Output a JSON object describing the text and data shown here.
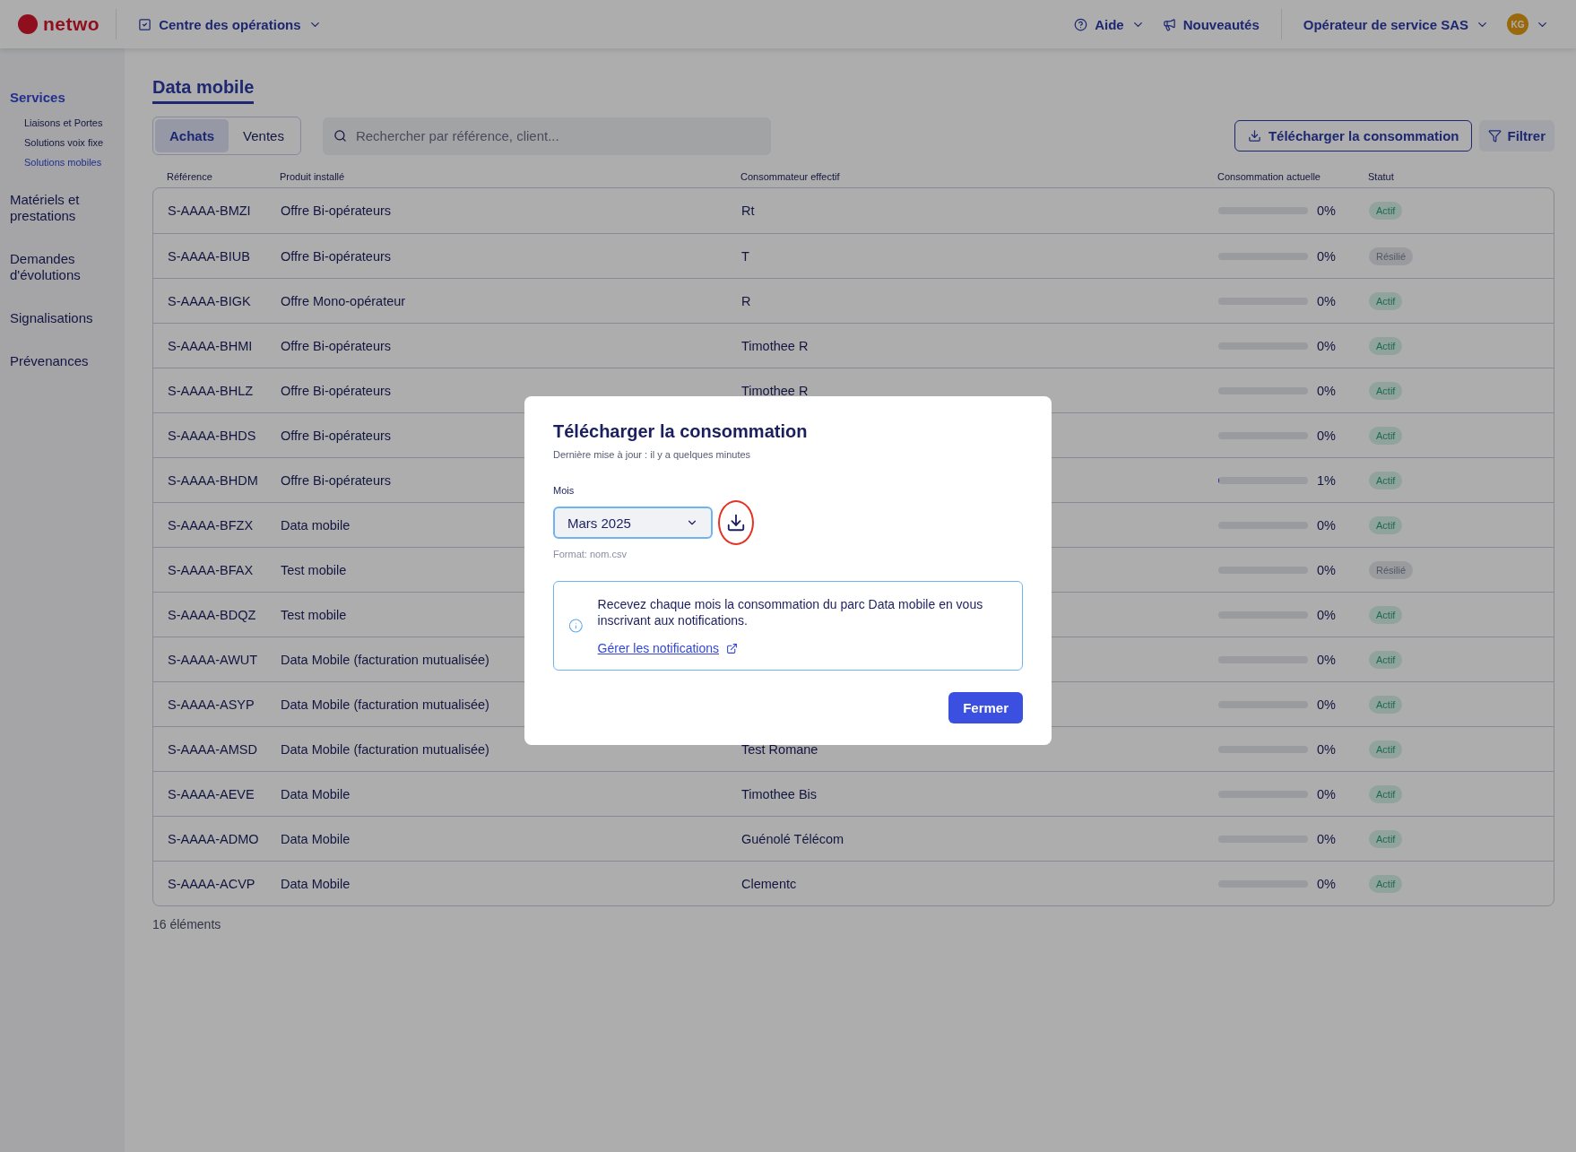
{
  "header": {
    "logo": "netwo",
    "app_menu": "Centre des opérations",
    "help": "Aide",
    "news": "Nouveautés",
    "account": "Opérateur de service SAS",
    "avatar": "KG"
  },
  "sidebar": {
    "items": [
      {
        "label": "Services",
        "selected": true,
        "children": [
          {
            "label": "Liaisons et Portes",
            "selected": false
          },
          {
            "label": "Solutions voix fixe",
            "selected": false
          },
          {
            "label": "Solutions mobiles",
            "selected": true
          }
        ]
      },
      {
        "label": "Matériels et prestations",
        "selected": false
      },
      {
        "label": "Demandes d'évolutions",
        "selected": false
      },
      {
        "label": "Signalisations",
        "selected": false
      },
      {
        "label": "Prévenances",
        "selected": false
      }
    ]
  },
  "page": {
    "title": "Data mobile",
    "tabs": [
      {
        "label": "Achats",
        "selected": true
      },
      {
        "label": "Ventes",
        "selected": false
      }
    ],
    "search": {
      "placeholder": "Rechercher par référence, client..."
    },
    "download_button": "Télécharger la consommation",
    "filter_button": "Filtrer"
  },
  "table": {
    "columns": [
      "Référence",
      "Produit installé",
      "Consommateur effectif",
      "Consommation actuelle",
      "Statut"
    ],
    "rows": [
      {
        "reference": "S-AAAA-BMZI",
        "product": "Offre Bi-opérateurs",
        "consumer": "Rt",
        "level": 0,
        "reading": "0%",
        "status": "Actif",
        "kind": "active"
      },
      {
        "reference": "S-AAAA-BIUB",
        "product": "Offre Bi-opérateurs",
        "consumer": "T",
        "level": 0,
        "reading": "0%",
        "status": "Résilié",
        "kind": "terminated"
      },
      {
        "reference": "S-AAAA-BIGK",
        "product": "Offre Mono-opérateur",
        "consumer": "R",
        "level": 0,
        "reading": "0%",
        "status": "Actif",
        "kind": "active"
      },
      {
        "reference": "S-AAAA-BHMI",
        "product": "Offre Bi-opérateurs",
        "consumer": "Timothee R",
        "level": 0,
        "reading": "0%",
        "status": "Actif",
        "kind": "active"
      },
      {
        "reference": "S-AAAA-BHLZ",
        "product": "Offre Bi-opérateurs",
        "consumer": "Timothee R",
        "level": 0,
        "reading": "0%",
        "status": "Actif",
        "kind": "active"
      },
      {
        "reference": "S-AAAA-BHDS",
        "product": "Offre Bi-opérateurs",
        "level": 0,
        "reading": "0%",
        "status": "Actif",
        "kind": "active"
      },
      {
        "reference": "S-AAAA-BHDM",
        "product": "Offre Bi-opérateurs",
        "level": 0.01,
        "reading": "1%",
        "status": "Actif",
        "kind": "active"
      },
      {
        "reference": "S-AAAA-BFZX",
        "product": "Data mobile",
        "level": 0,
        "reading": "0%",
        "status": "Actif",
        "kind": "active"
      },
      {
        "reference": "S-AAAA-BFAX",
        "product": "Test mobile",
        "level": 0,
        "reading": "0%",
        "status": "Résilié",
        "kind": "terminated"
      },
      {
        "reference": "S-AAAA-BDQZ",
        "product": "Test mobile",
        "level": 0,
        "reading": "0%",
        "status": "Actif",
        "kind": "active"
      },
      {
        "reference": "S-AAAA-AWUT",
        "product": "Data Mobile (facturation mutualisée)",
        "level": 0,
        "reading": "0%",
        "status": "Actif",
        "kind": "active"
      },
      {
        "reference": "S-AAAA-ASYP",
        "product": "Data Mobile (facturation mutualisée)",
        "level": 0,
        "reading": "0%",
        "status": "Actif",
        "kind": "active"
      },
      {
        "reference": "S-AAAA-AMSD",
        "product": "Data Mobile (facturation mutualisée)",
        "consumer": "Test Romane",
        "level": 0,
        "reading": "0%",
        "status": "Actif",
        "kind": "active"
      },
      {
        "reference": "S-AAAA-AEVE",
        "product": "Data Mobile",
        "consumer": "Timothee Bis",
        "level": 0,
        "reading": "0%",
        "status": "Actif",
        "kind": "active"
      },
      {
        "reference": "S-AAAA-ADMO",
        "product": "Data Mobile",
        "consumer": "Guénolé Télécom",
        "level": 0,
        "reading": "0%",
        "status": "Actif",
        "kind": "active"
      },
      {
        "reference": "S-AAAA-ACVP",
        "product": "Data Mobile",
        "consumer": "Clementc",
        "level": 0,
        "reading": "0%",
        "status": "Actif",
        "kind": "active"
      }
    ],
    "count": "16 éléments"
  },
  "modal": {
    "title": "Télécharger la consommation",
    "subtitle": "Dernière mise à jour : il y a quelques minutes",
    "month_label": "Mois",
    "month_value": "Mars 2025",
    "format_hint": "Format: nom.csv",
    "info_text": "Recevez chaque mois la consommation du parc Data mobile en vous inscrivant aux notifications.",
    "info_link": "Gérer les notifications",
    "close_button": "Fermer"
  }
}
